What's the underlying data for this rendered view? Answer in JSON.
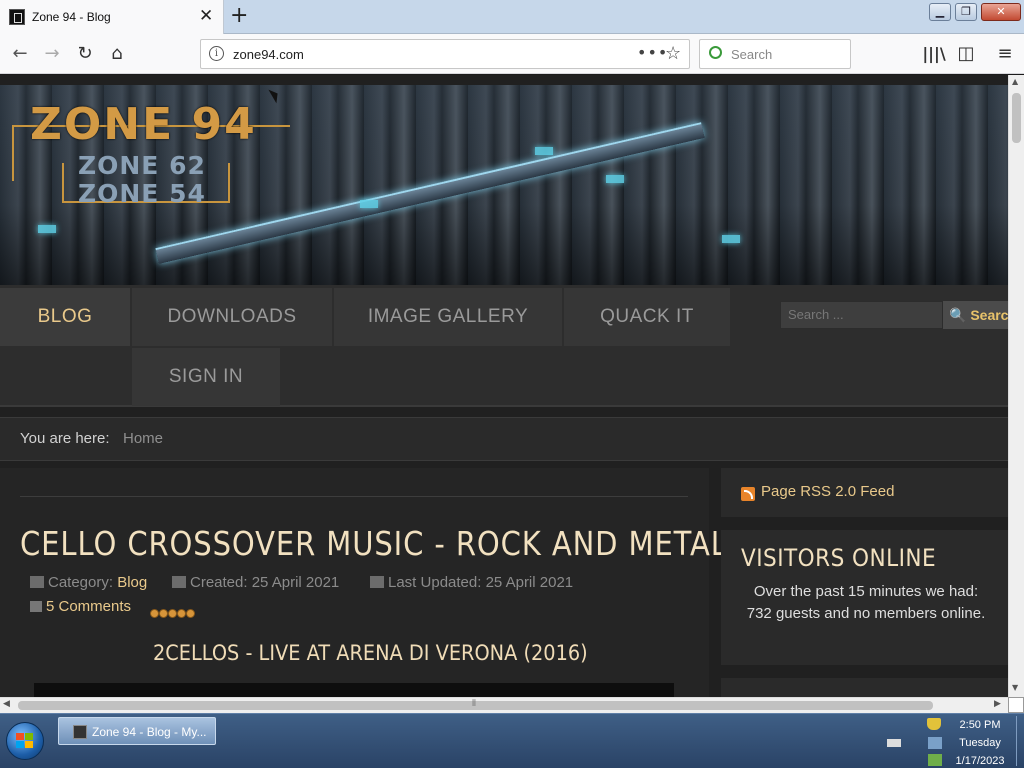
{
  "browser": {
    "tab_title": "Zone 94 - Blog",
    "url": "zone94.com",
    "search_placeholder": "Search"
  },
  "site": {
    "logo_main": "ZONE 94",
    "logo_sub1": "ZONE 62",
    "logo_sub2": "ZONE 54",
    "menu": [
      "BLOG",
      "DOWNLOADS",
      "IMAGE GALLERY",
      "QUACK IT",
      "SIGN IN"
    ],
    "active_menu": "BLOG",
    "search_placeholder": "Search ...",
    "search_button": "Search"
  },
  "breadcrumb": {
    "label": "You are here:",
    "home": "Home"
  },
  "article": {
    "title": "CELLO CROSSOVER MUSIC - ROCK AND METAL",
    "category_label": "Category:",
    "category": "Blog",
    "created": "Created: 25 April 2021",
    "updated": "Last Updated: 25 April 2021",
    "comments": "5 Comments",
    "subtitle": "2CELLOS - LIVE AT ARENA DI VERONA (2016)"
  },
  "sidebar": {
    "rss": "Page RSS 2.0 Feed",
    "visitors_title": "VISITORS ONLINE",
    "visitors_text": "Over the past 15 minutes we had: 732 guests and no members online."
  },
  "taskbar": {
    "task_label": "Zone 94 - Blog - My...",
    "time": "2:50 PM",
    "day": "Tuesday",
    "date": "1/17/2023"
  },
  "colors": {
    "accent": "#e9c98b",
    "heading": "#f2e1c0",
    "menu_text": "#9a9a9a"
  }
}
